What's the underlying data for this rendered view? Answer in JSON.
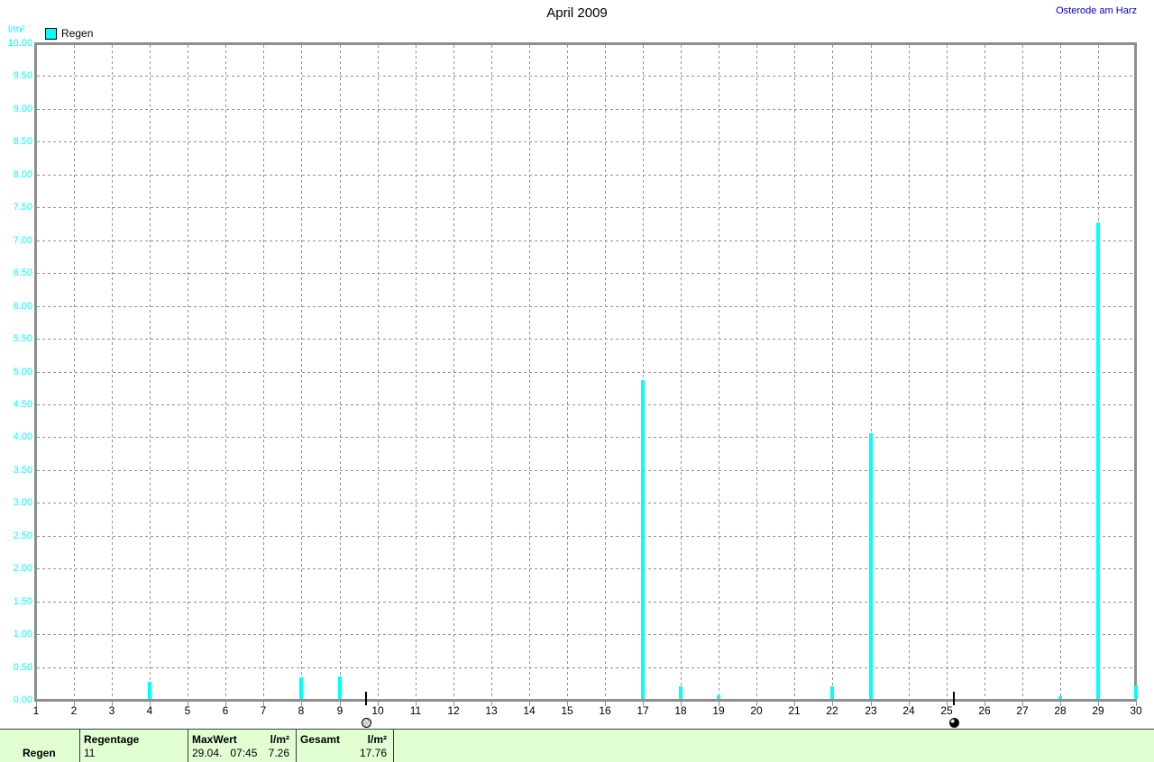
{
  "header": {
    "title": "April 2009",
    "station": "Osterode am Harz"
  },
  "legend": {
    "label": "Regen",
    "swatch_color": "#00ffff"
  },
  "y_axis": {
    "unit": "l/m²",
    "tick_labels": [
      "10.00",
      "9.50",
      "9.00",
      "8.50",
      "8.00",
      "7.50",
      "7.00",
      "6.50",
      "6.00",
      "5.50",
      "5.00",
      "4.50",
      "4.00",
      "3.50",
      "3.00",
      "2.50",
      "2.00",
      "1.50",
      "1.00",
      "0.50",
      "0.00"
    ]
  },
  "x_axis": {
    "day_labels": [
      "1",
      "2",
      "3",
      "4",
      "5",
      "6",
      "7",
      "8",
      "9",
      "10",
      "11",
      "12",
      "13",
      "14",
      "15",
      "16",
      "17",
      "18",
      "19",
      "20",
      "21",
      "22",
      "23",
      "24",
      "25",
      "26",
      "27",
      "28",
      "29",
      "30"
    ]
  },
  "chart_data": {
    "type": "bar",
    "title": "April 2009",
    "ylabel": "l/m²",
    "ylim": [
      0,
      10
    ],
    "ytick_step": 0.5,
    "x_range": [
      1,
      30
    ],
    "grid": true,
    "legend_position": "top-left",
    "series": [
      {
        "name": "Regen",
        "color": "#00ffff",
        "values_by_day": [
          0,
          0,
          0,
          0.26,
          0,
          0,
          0,
          0.33,
          0.34,
          0,
          0,
          0,
          0,
          0,
          0,
          0,
          4.85,
          0.19,
          0.05,
          0,
          0,
          0.19,
          4.05,
          0,
          0,
          0,
          0,
          0.04,
          7.26,
          0.2
        ]
      }
    ],
    "moon_markers": [
      {
        "day": 9.7,
        "phase": "full-moon"
      },
      {
        "day": 25.2,
        "phase": "new-moon"
      }
    ]
  },
  "summary": {
    "row_label": "Regen",
    "regentage": {
      "header": "Regentage",
      "value": "11"
    },
    "maxwert": {
      "header": "MaxWert",
      "unit": "l/m²",
      "date": "29.04.",
      "time": "07:45",
      "value": "7.26"
    },
    "gesamt": {
      "header": "Gesamt",
      "unit": "l/m²",
      "value": "17.76"
    }
  },
  "colors": {
    "bar": "#00ffff",
    "axis_gray": "#8e8e8e",
    "grid_gray": "#929292",
    "ylabel_cyan": "#00ffff",
    "station_blue": "#0000cc",
    "table_green": "#e1ffd3"
  }
}
